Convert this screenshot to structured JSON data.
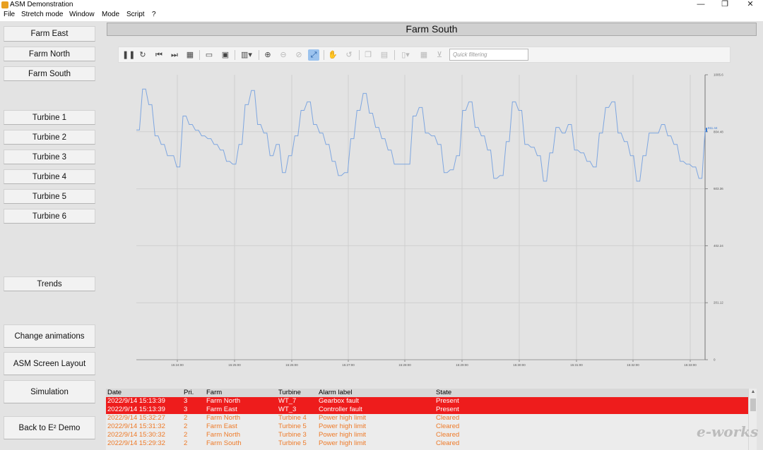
{
  "window": {
    "title": "ASM Demonstration",
    "controls": [
      "—",
      "❐",
      "✕"
    ]
  },
  "menu": [
    "File",
    "Stretch mode",
    "Window",
    "Mode",
    "Script",
    "?"
  ],
  "sidebar": {
    "farms": [
      "Farm East",
      "Farm North",
      "Farm South"
    ],
    "turbines": [
      "Turbine 1",
      "Turbine 2",
      "Turbine 3",
      "Turbine 4",
      "Turbine 5",
      "Turbine 6"
    ],
    "trends": "Trends",
    "actions": [
      "Change animations",
      "ASM Screen Layout",
      "Simulation",
      "Back to E² Demo"
    ]
  },
  "header": {
    "title": "Farm South"
  },
  "toolbar": {
    "quick_filter_placeholder": "Quick filtering",
    "buttons": [
      "pause-icon",
      "refresh-icon",
      "skip-back-icon",
      "skip-forward-icon",
      "calendar-icon",
      "open-folder-icon",
      "save-icon",
      "columns-icon",
      "zoom-in-icon",
      "zoom-out-icon",
      "zoom-reset-icon",
      "pan-icon",
      "hand-icon",
      "undo-icon",
      "copy-icon",
      "paste-icon",
      "layout-icon",
      "grid-icon",
      "filter-icon"
    ]
  },
  "chart_data": {
    "type": "line",
    "title": "",
    "xlabel": "",
    "ylabel": "",
    "grid": true,
    "x_ticks": [
      "15:24:00",
      "15:25:00",
      "15:26:00",
      "15:27:00",
      "15:28:00",
      "15:29:00",
      "15:30:00",
      "15:31:00",
      "15:32:00",
      "15:33:00"
    ],
    "y_ticks": [
      "1005.6",
      "804.48",
      "603.36",
      "402.24",
      "201.12",
      "0"
    ],
    "ylim": [
      0,
      1005.6
    ],
    "current_value_label": "811.44",
    "series": [
      {
        "values": [
          811,
          811,
          955,
          955,
          900,
          900,
          790,
          790,
          760,
          760,
          720,
          720,
          720,
          680,
          680,
          860,
          860,
          830,
          830,
          810,
          810,
          790,
          790,
          780,
          780,
          760,
          760,
          740,
          740,
          700,
          700,
          690,
          690,
          760,
          760,
          900,
          900,
          950,
          950,
          830,
          830,
          800,
          800,
          720,
          720,
          760,
          760,
          660,
          660,
          720,
          720,
          790,
          790,
          880,
          880,
          910,
          910,
          830,
          830,
          800,
          800,
          760,
          760,
          700,
          700,
          650,
          650,
          660,
          660,
          780,
          780,
          880,
          880,
          940,
          940,
          870,
          870,
          820,
          820,
          780,
          780,
          740,
          740,
          690,
          690,
          690,
          690,
          690,
          690,
          860,
          860,
          890,
          890,
          800,
          800,
          790,
          790,
          760,
          760,
          660,
          660,
          670,
          670,
          720,
          720,
          880,
          880,
          910,
          910,
          820,
          820,
          790,
          790,
          740,
          740,
          640,
          640,
          650,
          650,
          770,
          770,
          910,
          910,
          880,
          880,
          760,
          760,
          750,
          750,
          720,
          720,
          630,
          630,
          730,
          730,
          820,
          820,
          800,
          800,
          830,
          830,
          740,
          740,
          730,
          730,
          700,
          700,
          680,
          680,
          800,
          800,
          890,
          890,
          910,
          910,
          800,
          800,
          770,
          770,
          720,
          720,
          630,
          630,
          720,
          720,
          800,
          800,
          800,
          800,
          830,
          830,
          790,
          790,
          760,
          760,
          700,
          700,
          690,
          690,
          680,
          680,
          640,
          640,
          811
        ]
      }
    ]
  },
  "alarms": {
    "columns": [
      "Date",
      "Pri.",
      "Farm",
      "Turbine",
      "Alarm label",
      "State"
    ],
    "rows": [
      [
        "2022/9/14 15:13:39",
        "3",
        "Farm North",
        "WT_7",
        "Gearbox fault",
        "Present"
      ],
      [
        "2022/9/14 15:13:39",
        "3",
        "Farm East",
        "WT_3",
        "Controller fault",
        "Present"
      ],
      [
        "2022/9/14 15:32:27",
        "2",
        "Farm North",
        "Turbine 4",
        "Power high limit",
        "Cleared"
      ],
      [
        "2022/9/14 15:31:32",
        "2",
        "Farm East",
        "Turbine 5",
        "Power high limit",
        "Cleared"
      ],
      [
        "2022/9/14 15:30:32",
        "2",
        "Farm North",
        "Turbine 3",
        "Power high limit",
        "Cleared"
      ],
      [
        "2022/9/14 15:29:32",
        "2",
        "Farm South",
        "Turbine 5",
        "Power high limit",
        "Cleared"
      ]
    ]
  },
  "watermark": "e-works",
  "colors": {
    "present": "#ee1c1c",
    "cleared": "#ee7a28",
    "line": "#7ea6e0"
  }
}
